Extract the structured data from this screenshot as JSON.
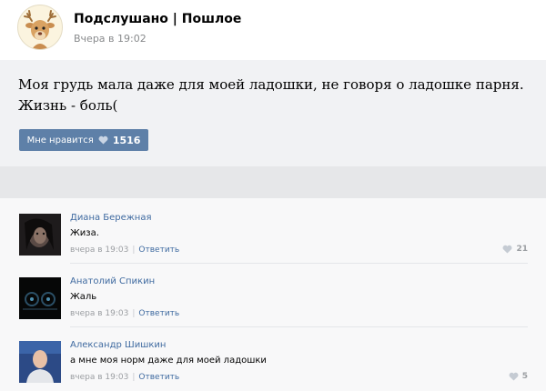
{
  "post": {
    "group_name": "Подслушано | Пошлое",
    "date": "Вчера в 19:02",
    "text": "Моя грудь мала даже для моей ладошки, не говоря о ладошке парня. Жизнь - боль(",
    "like_label": "Мне нравится",
    "like_count": "1516"
  },
  "comments": [
    {
      "author": "Диана Бережная",
      "text": "Жиза.",
      "time": "вчера в 19:03",
      "reply_label": "Ответить",
      "likes": "21"
    },
    {
      "author": "Анатолий Спикин",
      "text": "Жаль",
      "time": "вчера в 19:03",
      "reply_label": "Ответить",
      "likes": ""
    },
    {
      "author": "Александр Шишкин",
      "text": "а мне моя норм даже для моей ладошки",
      "time": "вчера в 19:03",
      "reply_label": "Ответить",
      "likes": "5"
    }
  ],
  "colors": {
    "like_button": "#5e80a8",
    "link": "#3f6aa0",
    "post_background": "#f1f2f4",
    "meta_text": "#9b9ea2"
  },
  "icons": {
    "like": "heart-icon",
    "group_avatar": "deer-avatar-icon"
  }
}
